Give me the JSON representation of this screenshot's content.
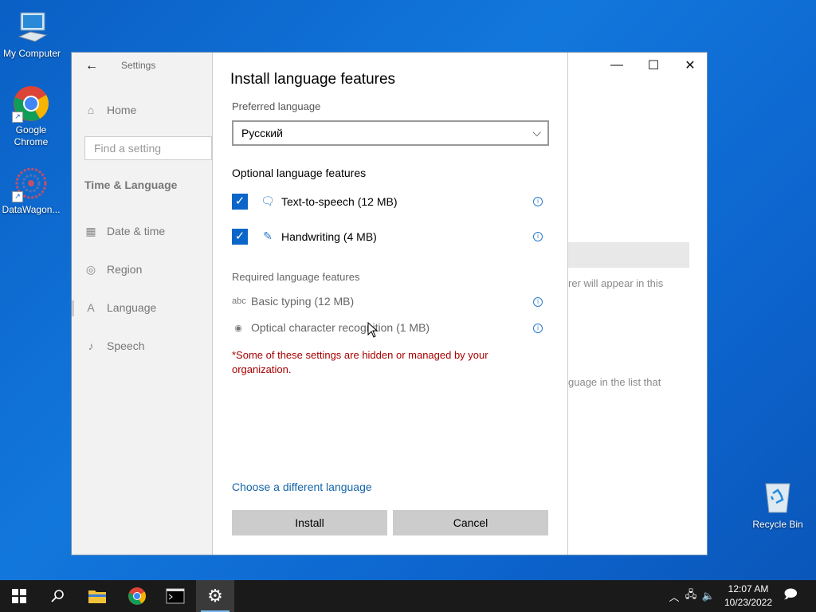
{
  "desktop": {
    "icons": [
      {
        "label": "My Computer"
      },
      {
        "label": "Google Chrome"
      },
      {
        "label": "DataWagon..."
      }
    ],
    "recycle_bin": "Recycle Bin"
  },
  "settings": {
    "window_title": "Settings",
    "nav": {
      "home": "Home",
      "search_placeholder": "Find a setting",
      "section": "Time & Language",
      "items": [
        {
          "label": "Date & time"
        },
        {
          "label": "Region"
        },
        {
          "label": "Language"
        },
        {
          "label": "Speech"
        }
      ]
    },
    "background_text": {
      "line1": "rer will appear in this",
      "line2": "guage in the list that"
    }
  },
  "dialog": {
    "title": "Install language features",
    "preferred_label": "Preferred language",
    "preferred_value": "Русский",
    "optional_header": "Optional language features",
    "optional": [
      {
        "label": "Text-to-speech (12 MB)",
        "checked": true
      },
      {
        "label": "Handwriting (4 MB)",
        "checked": true
      }
    ],
    "required_header": "Required language features",
    "required": [
      {
        "label": "Basic typing (12 MB)"
      },
      {
        "label": "Optical character recognition (1 MB)"
      }
    ],
    "warning": "*Some of these settings are hidden or managed by your organization.",
    "link": "Choose a different language",
    "install": "Install",
    "cancel": "Cancel"
  },
  "taskbar": {
    "time": "12:07 AM",
    "date": "10/23/2022"
  },
  "colors": {
    "accent": "#0a66c8",
    "warning": "#a80000",
    "link": "#1565a8",
    "desktop": "#1277dc",
    "taskbar": "#1a1a1a"
  }
}
